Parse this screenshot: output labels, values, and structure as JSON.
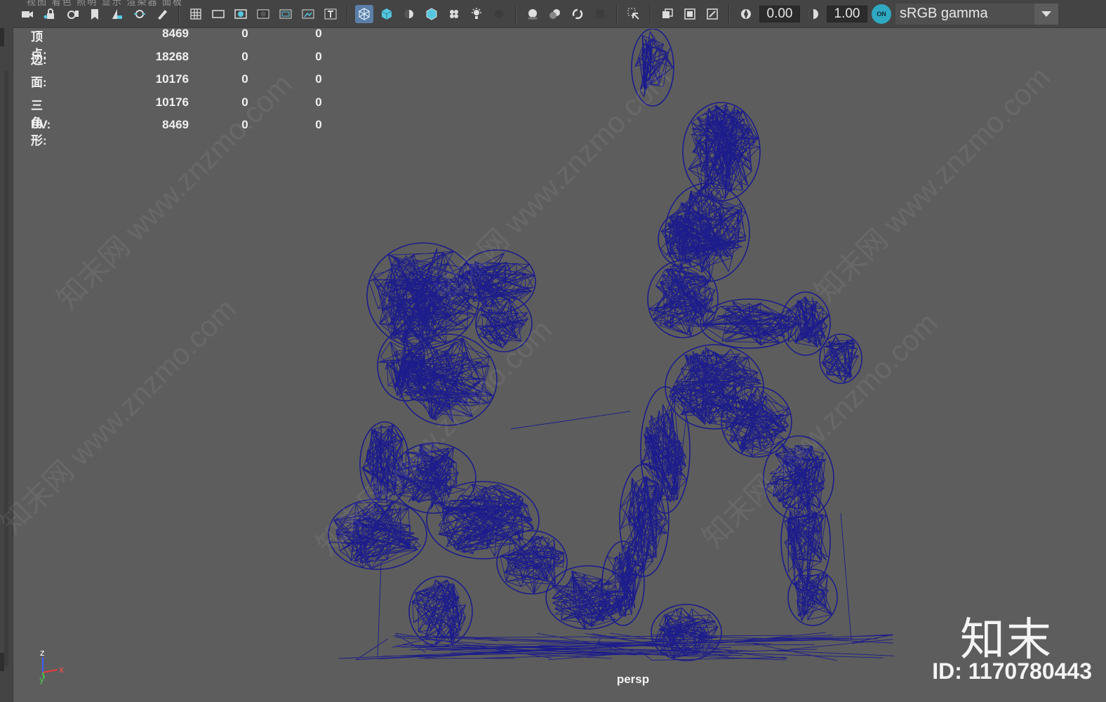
{
  "toolbar": {
    "menu_ghost": "视图   着色   照明   显示   渲染器   面板",
    "icons": [
      "camera-icon",
      "camera-lock-icon",
      "camera-attributes-icon",
      "bookmark-icon",
      "image-plane-icon",
      "2d-pan-zoom-icon",
      "grease-pencil-icon",
      "grid-icon",
      "film-gate-icon",
      "resolution-gate-icon",
      "gate-mask-icon",
      "field-chart-icon",
      "safe-action-icon",
      "safe-title-icon",
      "wireframe-icon",
      "smooth-shade-icon",
      "default-lighting-icon",
      "textured-icon",
      "use-all-lights-icon",
      "shadows-icon",
      "ambient-occlusion-icon",
      "xray-icon",
      "xray-joints-icon",
      "xray-components-icon",
      "backface-icon",
      "isolate-select-icon",
      "wireframe-on-shaded-icon",
      "xray-active-icon",
      "textures-icon",
      "exposure-icon",
      "gamma-icon",
      "color-management-icon"
    ],
    "exposure_value": "0.00",
    "gamma_value": "1.00",
    "color_mgmt_on": "ON",
    "color_space": "sRGB gamma"
  },
  "hud": {
    "rows": [
      {
        "label": "顶点:",
        "v1": "8469",
        "v2": "0",
        "v3": "0"
      },
      {
        "label": "边:",
        "v1": "18268",
        "v2": "0",
        "v3": "0"
      },
      {
        "label": "面:",
        "v1": "10176",
        "v2": "0",
        "v3": "0"
      },
      {
        "label": "三角形:",
        "v1": "10176",
        "v2": "0",
        "v3": "0"
      },
      {
        "label": "UV:",
        "v1": "8469",
        "v2": "0",
        "v3": "0"
      }
    ]
  },
  "viewport": {
    "camera_label": "persp",
    "axis": {
      "z": "z",
      "x": "x",
      "y": "y"
    },
    "mesh_color": "#1c1c8c",
    "watermark": "知末网 www.znzmo.com",
    "logo": "知末",
    "id_text": "ID: 1170780443"
  }
}
